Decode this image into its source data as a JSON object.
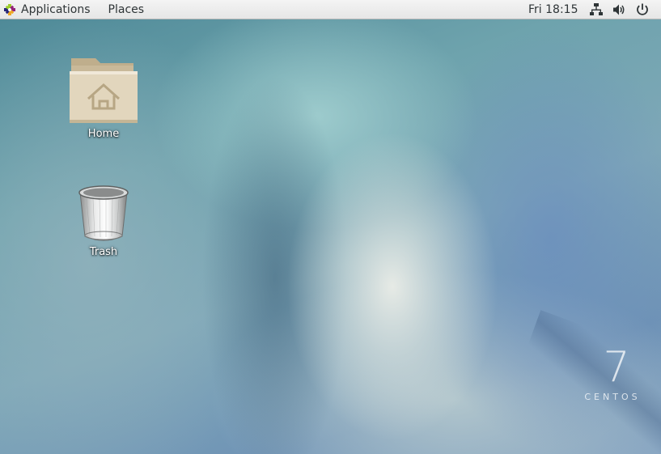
{
  "top_panel": {
    "applications_label": "Applications",
    "places_label": "Places",
    "clock": "Fri 18:15",
    "tray_icons": [
      "network-icon",
      "volume-icon",
      "power-icon"
    ]
  },
  "desktop": {
    "icons": [
      {
        "label": "Home",
        "icon": "home-folder-icon"
      },
      {
        "label": "Trash",
        "icon": "trash-icon"
      }
    ],
    "watermark": {
      "version": "7",
      "name": "CENTOS"
    }
  },
  "colors": {
    "panel_bg": "#ececec",
    "panel_text": "#2e3436",
    "folder": "#d9cbae",
    "wallpaper_base": "#6ea3ad"
  }
}
